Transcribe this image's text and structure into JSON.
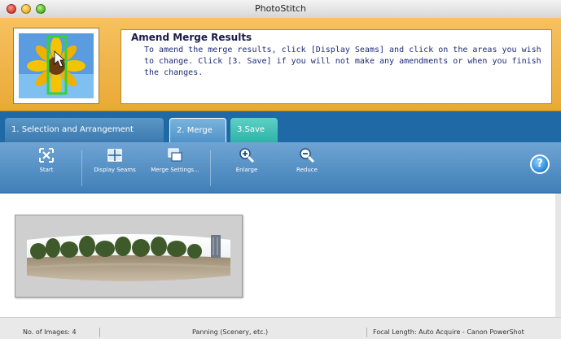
{
  "window": {
    "title": "PhotoStitch"
  },
  "header": {
    "heading": "Amend Merge Results",
    "body": "To amend the merge results, click [Display Seams] and click on the areas you wish to change. Click [3. Save] if you will not make any amendments or when you finish the changes."
  },
  "tabs": [
    {
      "label": "1. Selection and Arrangement",
      "active": false
    },
    {
      "label": "2. Merge",
      "active": true
    },
    {
      "label": "3.Save",
      "active": false
    }
  ],
  "toolbar": {
    "start_label": "Start",
    "display_seams_label": "Display Seams",
    "merge_settings_label": "Merge Settings...",
    "enlarge_label": "Enlarge",
    "reduce_label": "Reduce",
    "help_glyph": "?"
  },
  "status": {
    "images": "No. of Images: 4",
    "mode": "Panning (Scenery, etc.)",
    "focal": "Focal Length: Auto Acquire - Canon PowerShot"
  },
  "colors": {
    "header_bg": "#e9a936",
    "tab_strip": "#1f6aa6",
    "toolbar_bg": "#4f8ec4",
    "save_tab": "#2eb3a8"
  },
  "icons": [
    "start-icon",
    "display-seams-icon",
    "merge-settings-icon",
    "enlarge-icon",
    "reduce-icon",
    "help-icon"
  ]
}
